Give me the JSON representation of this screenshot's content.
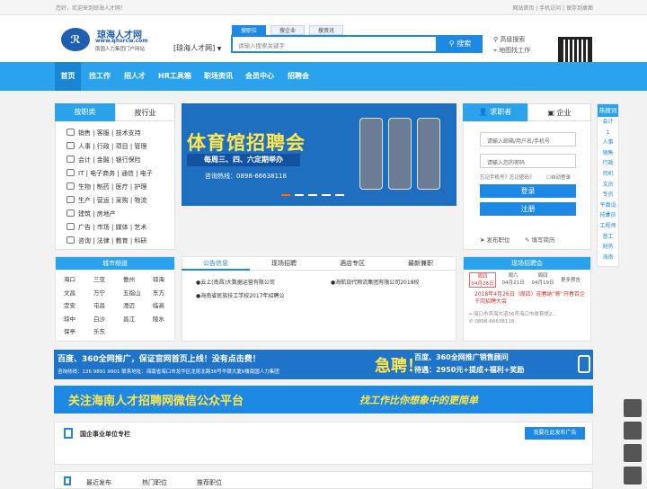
{
  "topbar": {
    "welcome": "您好，欢迎来到琼海人才网！",
    "links": "网站首页 | 手机访问 | 保存到桌面"
  },
  "logo": {
    "mark": "ℛ",
    "name": "琼海人才网",
    "url": "www.qhsrcw.com",
    "slogan": "南国人力集团门户网站"
  },
  "city": "[琼海人才网]",
  "search": {
    "tabs": [
      "搜职位",
      "搜企业",
      "搜资讯"
    ],
    "placeholder": "请输入搜索关键字",
    "button": "搜索",
    "advanced": "高级搜索",
    "map": "地图找工作"
  },
  "nav": {
    "items": [
      "首页",
      "找工作",
      "招人才",
      "HR工具箱",
      "职场资讯",
      "会员中心",
      "招聘会"
    ]
  },
  "left_tabs": {
    "a": "按职类",
    "b": "按行业"
  },
  "categories": [
    "销售 | 客服 | 技术支持",
    "人事 | 行政 | 项目 | 管理",
    "会计 | 金融 | 银行保险",
    "IT | 电子商务 | 通信 | 电子",
    "生物 | 制药 | 医疗 | 护理",
    "生产 | 营运 | 采购 | 物流",
    "建筑 | 房地产",
    "广告 | 市场 | 媒体 | 艺术",
    "咨询 | 法律 | 教育 | 科研"
  ],
  "banner": {
    "title": "体育馆招聘会",
    "subtitle": "每周三、四、六定期举办",
    "hotline": "咨询热线：0898-66638118"
  },
  "login": {
    "tab_a": "求职者",
    "tab_b": "企业",
    "user_ph": "请输入邮箱/用户名/手机号",
    "pwd_ph": "请输入您的密码",
    "forgot": "忘记手机号？忘记密码？",
    "auto": "自动登录",
    "login_btn": "登录",
    "reg_btn": "注册",
    "post": "发布职位",
    "resume": "填写简历"
  },
  "hot": {
    "title": "热搜词",
    "items": [
      "会计",
      "1",
      "人事",
      "销售",
      "行政",
      "司机",
      "文员",
      "专员",
      "平面设计",
      "技术员",
      "工程师",
      "普工",
      "财务",
      "海南"
    ]
  },
  "city_section": {
    "title": "城市频道",
    "cells": [
      "海口",
      "三亚",
      "儋州",
      "琼海",
      "文昌",
      "万宁",
      "五指山",
      "东方",
      "定安",
      "屯昌",
      "澄迈",
      "临高",
      "琼中",
      "白沙",
      "昌江",
      "陵水",
      "保亭",
      "乐东"
    ]
  },
  "news_tabs": [
    "公告信息",
    "现场招聘",
    "酒店专区",
    "最新兼职"
  ],
  "news": [
    "●云上(南昌)大数据运营有限公司",
    "●海航现代物流集团有限公司2018校",
    "●海南省民族技工学校2017年招聘公"
  ],
  "fair": {
    "title": "现场招聘会",
    "dates": [
      [
        "周四",
        "04月26日"
      ],
      [
        "周六",
        "04月21日"
      ],
      [
        "周四",
        "04月19日"
      ]
    ],
    "more": "更多预告",
    "headline": "2018年4月26日（周四）迎春纳”薪”开春百企千岗招聘大会",
    "addr": "海口市滨海大道36号海口市体育馆2...",
    "tel": "0898-66638118"
  },
  "ad1": {
    "left": "百度、360全网推广，保证官网首页上线！没有点击费！",
    "tel": "咨询热线：136 9891 9901   联系地址：海南省海口市龙华区龙昆北路38号华银大厦6楼南国人力集团",
    "mid": "急聘！",
    "right": "百度、360全网推广销售顾问",
    "pay": "待遇：2950元+提成+福利+奖励"
  },
  "ad2": {
    "left": "关注海南人才招聘网微信公众平台",
    "right": "找工作比你想象中的更简单"
  },
  "soe": {
    "title": "国企事业单位专栏",
    "btn": "我要在此发布广告"
  },
  "bottom_tabs": [
    "最近发布",
    "热门职位",
    "推荐职位"
  ]
}
